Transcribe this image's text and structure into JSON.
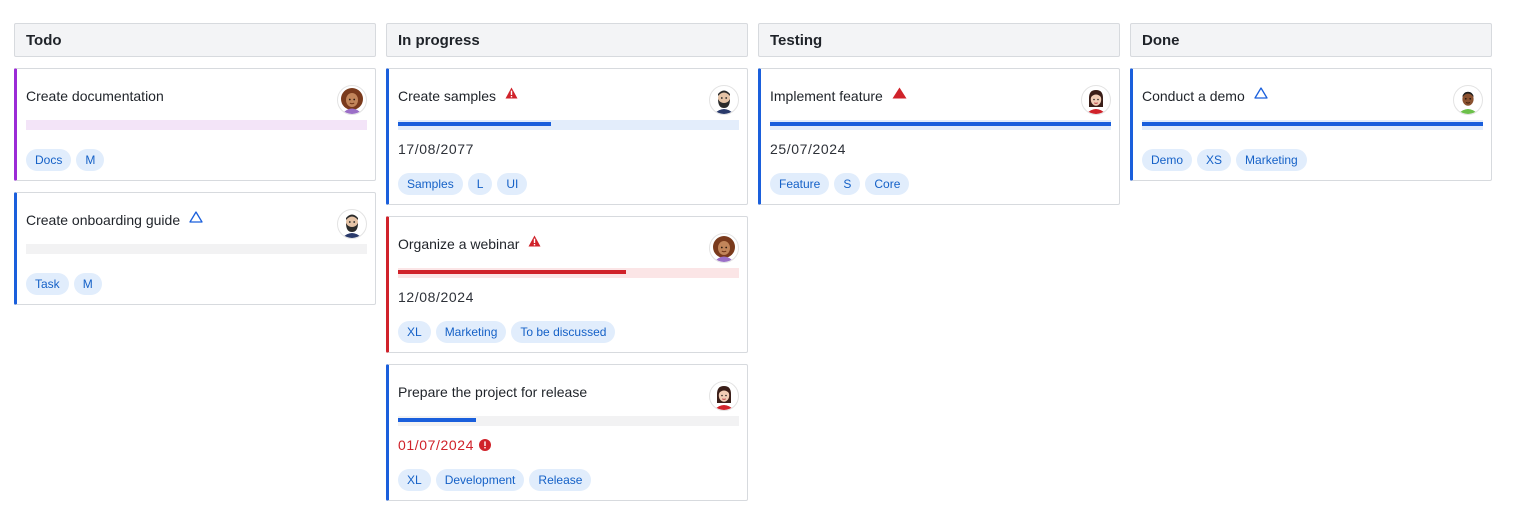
{
  "board": {
    "columns": [
      {
        "title": "Todo",
        "cards": [
          {
            "title": "Create documentation",
            "priority": "none",
            "progress": 0,
            "date": "",
            "overdue": false,
            "tags": [
              "Docs",
              "M"
            ],
            "avatar": "woman-curly",
            "accent": "#9b2bd6",
            "track": "#f3e4f8",
            "fill": "#9b2bd6"
          },
          {
            "title": "Create onboarding guide",
            "priority": "low",
            "progress": 0,
            "date": "",
            "overdue": false,
            "tags": [
              "Task",
              "M"
            ],
            "avatar": "man-beard",
            "accent": "#1a5fdc",
            "track": "#f2f2f3",
            "fill": "#1a5fdc"
          }
        ]
      },
      {
        "title": "In progress",
        "cards": [
          {
            "title": "Create samples",
            "priority": "high",
            "progress": 0.45,
            "date": "17/08/2077",
            "overdue": false,
            "tags": [
              "Samples",
              "L",
              "UI"
            ],
            "avatar": "man-beard",
            "accent": "#1a5fdc",
            "track": "#e3edfb",
            "fill": "#1a5fdc"
          },
          {
            "title": "Organize a webinar",
            "priority": "high",
            "progress": 0.67,
            "date": "12/08/2024",
            "overdue": false,
            "tags": [
              "XL",
              "Marketing",
              "To be discussed"
            ],
            "avatar": "woman-curly",
            "accent": "#d0222a",
            "track": "#fbe5e6",
            "fill": "#d0222a"
          },
          {
            "title": "Prepare the project for release",
            "priority": "none",
            "progress": 0.23,
            "date": "01/07/2024",
            "overdue": true,
            "tags": [
              "XL",
              "Development",
              "Release"
            ],
            "avatar": "woman-dark",
            "accent": "#1a5fdc",
            "track": "#f2f2f3",
            "fill": "#1a5fdc"
          }
        ]
      },
      {
        "title": "Testing",
        "cards": [
          {
            "title": "Implement feature",
            "priority": "critical",
            "progress": 1,
            "date": "25/07/2024",
            "overdue": false,
            "tags": [
              "Feature",
              "S",
              "Core"
            ],
            "avatar": "woman-dark",
            "accent": "#1a5fdc",
            "track": "#e3edfb",
            "fill": "#1a5fdc"
          }
        ]
      },
      {
        "title": "Done",
        "cards": [
          {
            "title": "Conduct a demo",
            "priority": "low",
            "progress": 1,
            "date": "",
            "overdue": false,
            "tags": [
              "Demo",
              "XS",
              "Marketing"
            ],
            "avatar": "man-green",
            "accent": "#1a5fdc",
            "track": "#e3edfb",
            "fill": "#1a5fdc"
          }
        ]
      }
    ]
  }
}
